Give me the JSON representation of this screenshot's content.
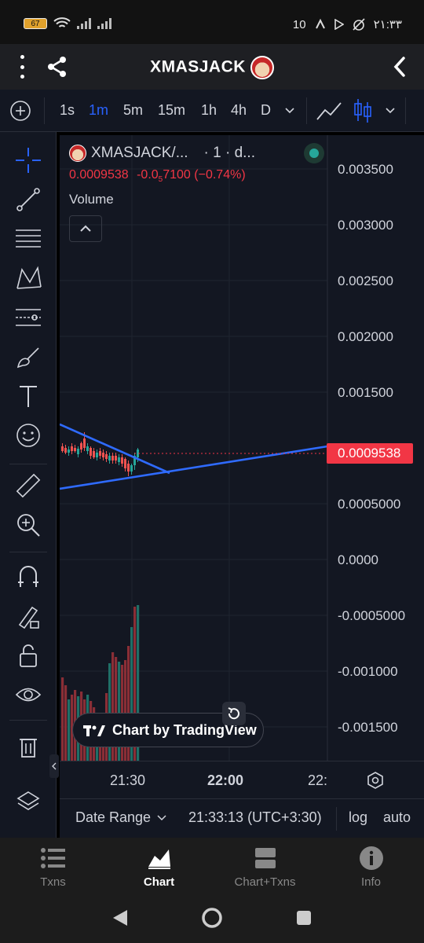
{
  "status_bar": {
    "battery": "67",
    "network": "10",
    "time": "۲۱:۳۳"
  },
  "header": {
    "title": "XMASJACK"
  },
  "timeframes": {
    "items": [
      "1s",
      "1m",
      "5m",
      "15m",
      "1h",
      "4h",
      "D"
    ],
    "active": "1m"
  },
  "legend": {
    "symbol": "XMASJACK/...",
    "interval": "· 1 · d...",
    "price": "0.0009538",
    "change": "-0.0",
    "change_sub": "5",
    "change_rest": "7100",
    "change_pct": "(−0.74%)",
    "volume_label": "Volume"
  },
  "price_axis": {
    "ticks": [
      "0.003500",
      "0.003000",
      "0.002500",
      "0.002000",
      "0.001500",
      "0.0005000",
      "0.0000",
      "-0.0005000",
      "-0.001000",
      "-0.001500"
    ],
    "current": "0.0009538"
  },
  "time_axis": {
    "ticks": [
      "21:30",
      "22:00",
      "22:"
    ]
  },
  "watermark": {
    "text": "Chart by TradingView"
  },
  "controls": {
    "date_range": "Date Range",
    "clock": "21:33:13 (UTC+3:30)",
    "log": "log",
    "auto": "auto"
  },
  "bottom_nav": {
    "items": [
      "Txns",
      "Chart",
      "Chart+Txns",
      "Info"
    ],
    "active": "Chart"
  },
  "colors": {
    "up": "#26a69a",
    "down": "#ef5350",
    "accent": "#2962ff",
    "trendline": "#2f6bff",
    "price_badge": "#f23645"
  }
}
